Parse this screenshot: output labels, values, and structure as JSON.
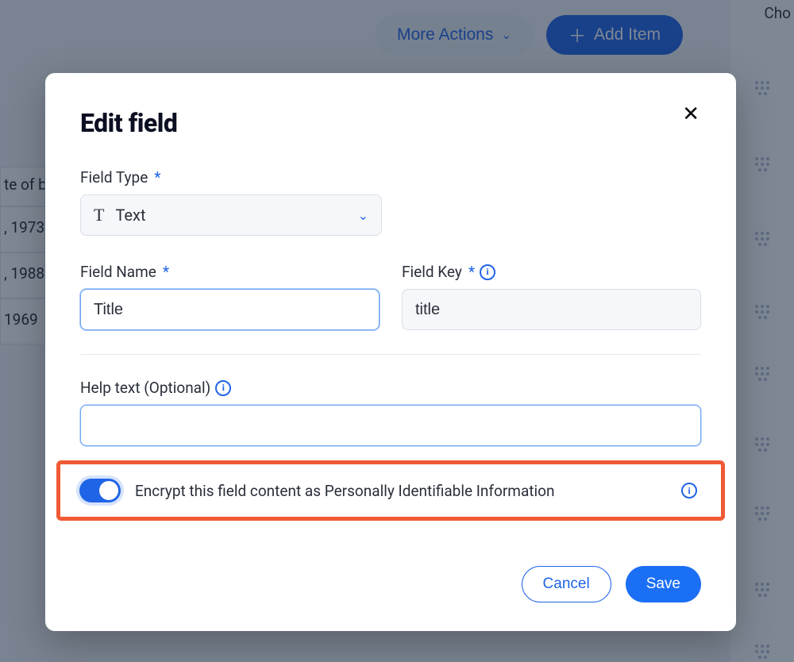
{
  "header": {
    "more_label": "More Actions",
    "add_label": "Add Item"
  },
  "bg_right_header": "Cho",
  "bg_left_rows": [
    "te of b",
    ", 1973",
    ", 1988",
    "1969 "
  ],
  "modal": {
    "title": "Edit field",
    "field_type_label": "Field Type",
    "field_type_value": "Text",
    "field_name_label": "Field Name",
    "field_name_value": "Title",
    "field_key_label": "Field Key",
    "field_key_value": "title",
    "help_text_label": "Help text (Optional)",
    "help_text_value": "",
    "encrypt_label": "Encrypt this field content as Personally Identifiable Information",
    "encrypt_on": true,
    "cancel_label": "Cancel",
    "save_label": "Save"
  }
}
